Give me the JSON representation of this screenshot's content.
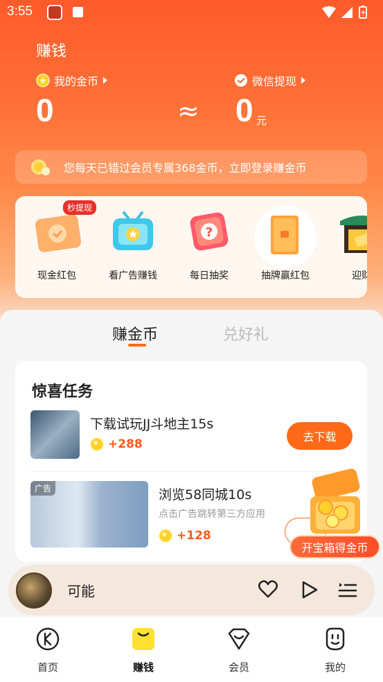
{
  "status_bar": {
    "time": "3:55"
  },
  "header": {
    "title": "赚钱",
    "coins_label": "我的金币",
    "coins_value": "0",
    "approx_symbol": "≈",
    "wechat_label": "微信提现",
    "wechat_value": "0",
    "wechat_unit": "元"
  },
  "notice": {
    "text": "您每天已错过会员专属368金币，立即登录赚金币"
  },
  "features": [
    {
      "label": "现金红包",
      "badge": "秒提现"
    },
    {
      "label": "看广告赚钱"
    },
    {
      "label": "每日抽奖"
    },
    {
      "label": "抽牌赢红包"
    },
    {
      "label": "迎财"
    }
  ],
  "tabs": {
    "earn": "赚金币",
    "gift": "兑好礼"
  },
  "tasks": {
    "title": "惊喜任务",
    "items": [
      {
        "name": "下载试玩JJ斗地主15s",
        "reward": "+288",
        "button": "去下载"
      },
      {
        "name": "浏览58同城10s",
        "desc": "点击广告跳转第三方应用",
        "reward": "+128",
        "ad_tag": "广告"
      }
    ]
  },
  "treasure": {
    "label": "开宝箱得金币"
  },
  "player": {
    "song": "可能"
  },
  "tabbar": [
    {
      "label": "首页"
    },
    {
      "label": "赚钱"
    },
    {
      "label": "会员"
    },
    {
      "label": "我的"
    }
  ],
  "colors": {
    "accent": "#ff6a1a",
    "hero_top": "#ff5a2a",
    "reward": "#ff5a1a"
  }
}
